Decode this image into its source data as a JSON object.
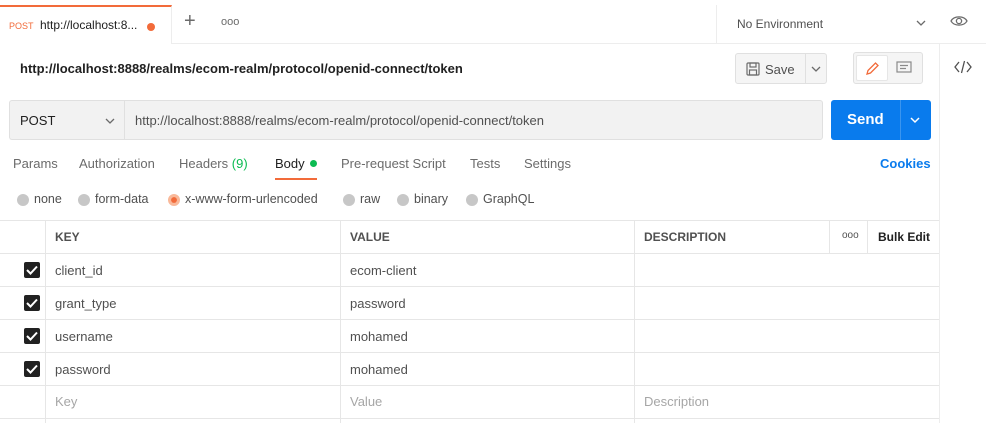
{
  "tab": {
    "method": "POST",
    "title": "http://localhost:8...",
    "unsaved_color": "#f26b3a"
  },
  "tabbar": {
    "more": "ooo"
  },
  "environment": {
    "label": "No Environment"
  },
  "request": {
    "name": "http://localhost:8888/realms/ecom-realm/protocol/openid-connect/token",
    "save_label": "Save"
  },
  "urlbar": {
    "method": "POST",
    "url": "http://localhost:8888/realms/ecom-realm/protocol/openid-connect/token",
    "send_label": "Send"
  },
  "request_tabs": [
    {
      "label": "Params"
    },
    {
      "label": "Authorization"
    },
    {
      "label": "Headers",
      "count": "(9)"
    },
    {
      "label": "Body",
      "active": true
    },
    {
      "label": "Pre-request Script"
    },
    {
      "label": "Tests"
    },
    {
      "label": "Settings"
    }
  ],
  "cookies_label": "Cookies",
  "body_types": [
    {
      "label": "none"
    },
    {
      "label": "form-data"
    },
    {
      "label": "x-www-form-urlencoded",
      "selected": true
    },
    {
      "label": "raw"
    },
    {
      "label": "binary"
    },
    {
      "label": "GraphQL"
    }
  ],
  "table": {
    "headers": {
      "key": "KEY",
      "value": "VALUE",
      "description": "DESCRIPTION",
      "more": "ooo",
      "bulk_edit": "Bulk Edit"
    },
    "rows": [
      {
        "key": "client_id",
        "value": "ecom-client",
        "checked": true
      },
      {
        "key": "grant_type",
        "value": "password",
        "checked": true
      },
      {
        "key": "username",
        "value": "mohamed",
        "checked": true
      },
      {
        "key": "password",
        "value": "mohamed",
        "checked": true
      }
    ],
    "placeholders": {
      "key": "Key",
      "value": "Value",
      "description": "Description"
    }
  },
  "colors": {
    "accent": "#f26b3a",
    "send": "#097bed",
    "link": "#097bed",
    "success": "#0cbb52"
  }
}
